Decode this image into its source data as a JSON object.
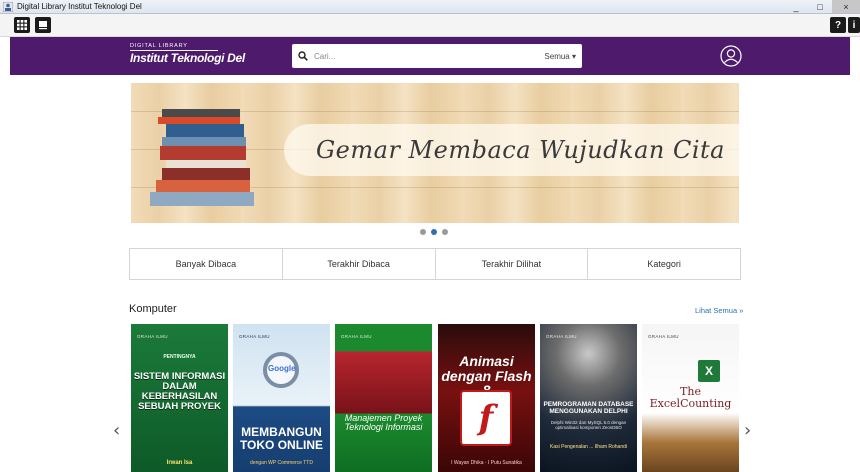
{
  "window": {
    "title": "Digital Library Institut Teknologi Del",
    "controls": [
      "_",
      "□",
      "×"
    ]
  },
  "toolbar": {
    "left_buttons": [
      {
        "icon": "grid-icon"
      },
      {
        "icon": "book-icon"
      }
    ],
    "right_buttons": [
      {
        "icon": "help-icon",
        "glyph": "?"
      },
      {
        "icon": "info-icon",
        "glyph": "i"
      }
    ]
  },
  "header": {
    "logo_small": "DIGITAL LIBRARY",
    "logo_big": "Institut Teknologi Del",
    "search": {
      "placeholder": "Cari...",
      "scope": "Semua ▾"
    },
    "accent_color": "#4e1a6b"
  },
  "banner": {
    "slogan": "Gemar Membaca Wujudkan Cita",
    "dots": 3,
    "active_dot": 1
  },
  "tabs": [
    "Banyak Dibaca",
    "Terakhir Dibaca",
    "Terakhir Dilihat",
    "Kategori"
  ],
  "section": {
    "title": "Komputer",
    "see_all": "Lihat Semua »"
  },
  "books": [
    {
      "publisher": "GRAHA ILMU",
      "subtitle": "PENTINGNYA",
      "title": "SISTEM INFORMASI DALAM KEBERHASILAN SEBUAH PROYEK",
      "author": "Irwan Isa"
    },
    {
      "publisher": "GRAHA ILMU",
      "logo_text": "Google",
      "title": "MEMBANGUN TOKO ONLINE",
      "subtitle": "dengan WP Commerce TTD"
    },
    {
      "publisher": "GRAHA ILMU",
      "title": "Manajemen Proyek Teknologi Informasi"
    },
    {
      "title": "Animasi dengan Flash 8",
      "logo": "f",
      "author": "I Wayan Dhika · I Putu Sunatika"
    },
    {
      "publisher": "GRAHA ILMU",
      "title": "PEMROGRAMAN DATABASE MENGGUNAKAN DELPHI",
      "subtitle": "Delphi Win32 dan MySQL 5.0 dengan optimalisasi komponen ZeosDBO",
      "author": "Kasi Pengenalan ... Ilham Rohandi"
    },
    {
      "publisher": "GRAHA ILMU",
      "title": "The ExcelCounting",
      "logo": "X"
    }
  ]
}
